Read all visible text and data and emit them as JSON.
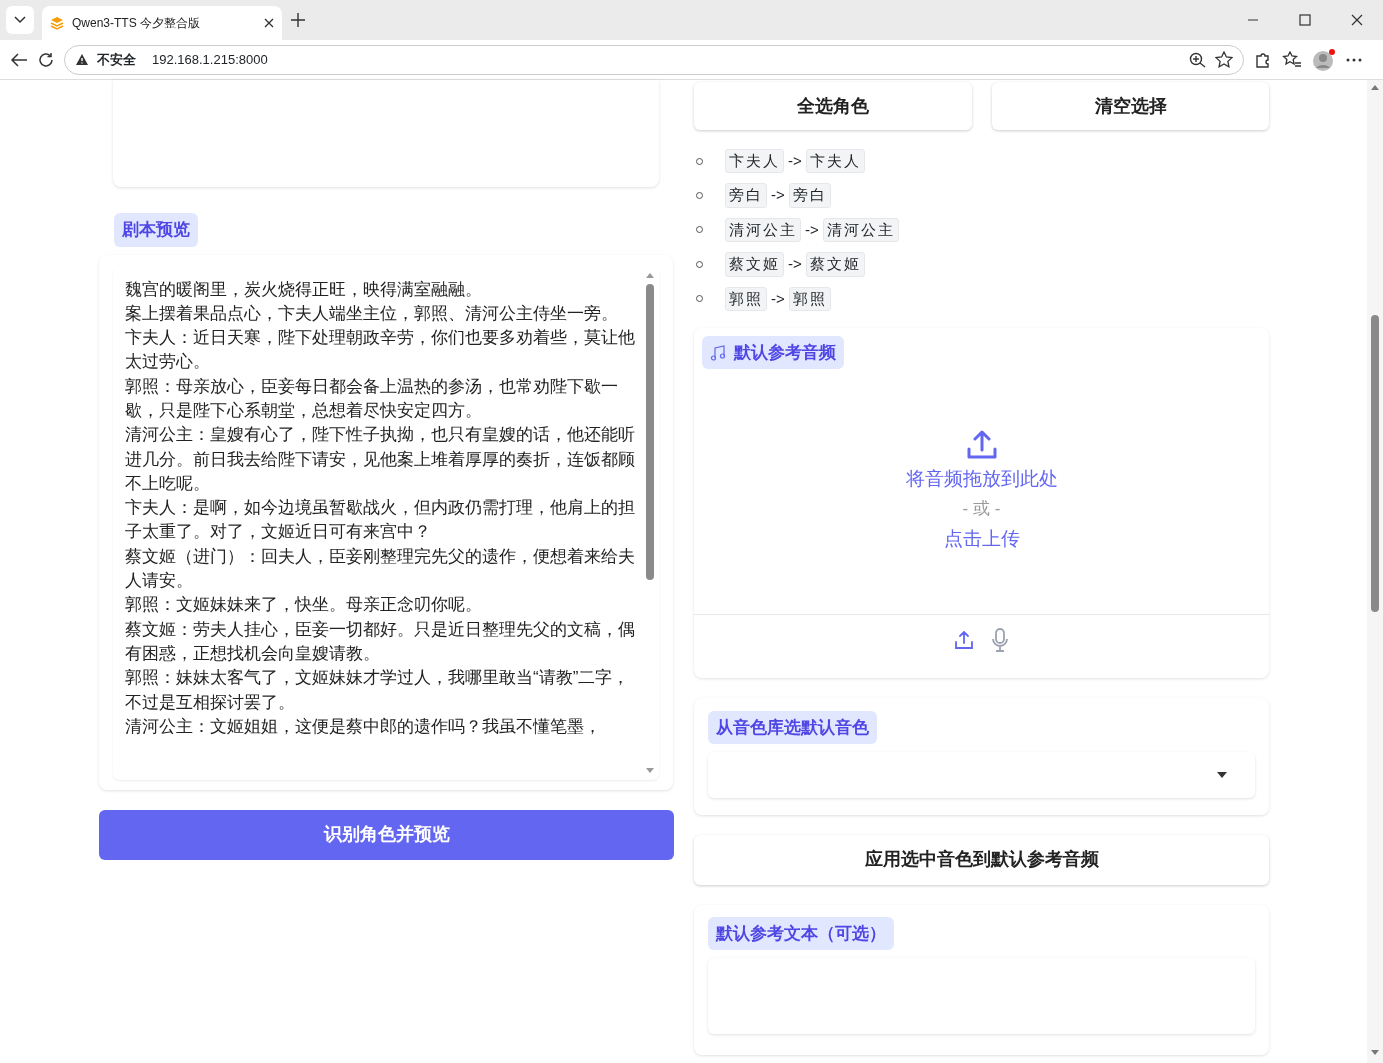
{
  "browser": {
    "tab_title": "Qwen3-TTS 今夕整合版",
    "security": "不安全",
    "url": "192.168.1.215:8000"
  },
  "left": {
    "script_label": "剧本预览",
    "script_lines": [
      "魏宫的暖阁里，炭火烧得正旺，映得满室融融。",
      "案上摆着果品点心，卞夫人端坐主位，郭照、清河公主侍坐一旁。",
      "卞夫人：近日天寒，陛下处理朝政辛劳，你们也要多劝着些，莫让他太过劳心。",
      "郭照：母亲放心，臣妾每日都会备上温热的参汤，也常劝陛下歇一歇，只是陛下心系朝堂，总想着尽快安定四方。",
      "清河公主：皇嫂有心了，陛下性子执拗，也只有皇嫂的话，他还能听进几分。前日我去给陛下请安，见他案上堆着厚厚的奏折，连饭都顾不上吃呢。",
      "卞夫人：是啊，如今边境虽暂歇战火，但内政仍需打理，他肩上的担子太重了。对了，文姬近日可有来宫中？",
      "蔡文姬（进门）：回夫人，臣妾刚整理完先父的遗作，便想着来给夫人请安。",
      "郭照：文姬妹妹来了，快坐。母亲正念叨你呢。",
      "蔡文姬：劳夫人挂心，臣妾一切都好。只是近日整理先父的文稿，偶有困惑，正想找机会向皇嫂请教。",
      "郭照：妹妹太客气了，文姬妹妹才学过人，我哪里敢当“请教”二字，不过是互相探讨罢了。",
      "清河公主：文姬姐姐，这便是蔡中郎的遗作吗？我虽不懂笔墨，"
    ],
    "detect_button": "识别角色并预览"
  },
  "right": {
    "select_all_button": "全选角色",
    "clear_button": "清空选择",
    "mappings": [
      {
        "from": "卞夫人",
        "arrow": "->",
        "to": "卞夫人"
      },
      {
        "from": "旁白",
        "arrow": "->",
        "to": "旁白"
      },
      {
        "from": "清河公主",
        "arrow": "->",
        "to": "清河公主"
      },
      {
        "from": "蔡文姬",
        "arrow": "->",
        "to": "蔡文姬"
      },
      {
        "from": "郭照",
        "arrow": "->",
        "to": "郭照"
      }
    ],
    "audio": {
      "label": "默认参考音频",
      "drop_text": "将音频拖放到此处",
      "or_text": "- 或 -",
      "click_text": "点击上传",
      "sources": [
        {
          "kind": "upload",
          "selected": true
        },
        {
          "kind": "microphone",
          "selected": false
        }
      ]
    },
    "voice_library": {
      "label": "从音色库选默认音色"
    },
    "apply_button": "应用选中音色到默认参考音频",
    "ref_text": {
      "label": "默认参考文本（可选）"
    }
  }
}
